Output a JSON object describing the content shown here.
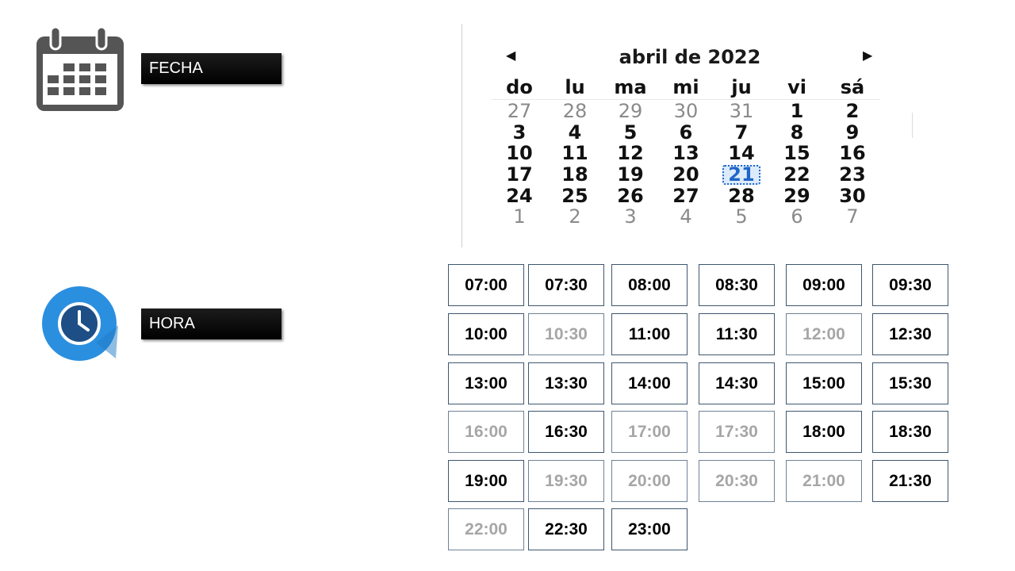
{
  "labels": {
    "fecha": "FECHA",
    "hora": "HORA"
  },
  "icons": {
    "calendar": "calendar-icon",
    "clock": "clock-icon",
    "prev": "chevron-left-icon",
    "next": "chevron-right-icon"
  },
  "colors": {
    "label_bg": "#000000",
    "clock_blue": "#2b8fe0",
    "calendar_gray": "#555555",
    "selected": "#1f66c9",
    "disabled_text": "#a6a6a6"
  },
  "calendar": {
    "title": "abril de 2022",
    "prev_symbol": "◀",
    "next_symbol": "▶",
    "weekdays": [
      "do",
      "lu",
      "ma",
      "mi",
      "ju",
      "vi",
      "sá"
    ],
    "weeks": [
      [
        {
          "d": "27",
          "o": 1
        },
        {
          "d": "28",
          "o": 1
        },
        {
          "d": "29",
          "o": 1
        },
        {
          "d": "30",
          "o": 1
        },
        {
          "d": "31",
          "o": 1
        },
        {
          "d": "1"
        },
        {
          "d": "2"
        }
      ],
      [
        {
          "d": "3"
        },
        {
          "d": "4"
        },
        {
          "d": "5"
        },
        {
          "d": "6"
        },
        {
          "d": "7"
        },
        {
          "d": "8"
        },
        {
          "d": "9"
        }
      ],
      [
        {
          "d": "10"
        },
        {
          "d": "11"
        },
        {
          "d": "12"
        },
        {
          "d": "13"
        },
        {
          "d": "14"
        },
        {
          "d": "15"
        },
        {
          "d": "16"
        }
      ],
      [
        {
          "d": "17"
        },
        {
          "d": "18"
        },
        {
          "d": "19"
        },
        {
          "d": "20"
        },
        {
          "d": "21",
          "s": 1
        },
        {
          "d": "22"
        },
        {
          "d": "23"
        }
      ],
      [
        {
          "d": "24"
        },
        {
          "d": "25"
        },
        {
          "d": "26"
        },
        {
          "d": "27"
        },
        {
          "d": "28"
        },
        {
          "d": "29"
        },
        {
          "d": "30"
        }
      ],
      [
        {
          "d": "1",
          "o": 1
        },
        {
          "d": "2",
          "o": 1
        },
        {
          "d": "3",
          "o": 1
        },
        {
          "d": "4",
          "o": 1
        },
        {
          "d": "5",
          "o": 1
        },
        {
          "d": "6",
          "o": 1
        },
        {
          "d": "7",
          "o": 1
        }
      ]
    ],
    "selected_day": "21"
  },
  "time_slots": [
    {
      "t": "07:00",
      "available": true
    },
    {
      "t": "07:30",
      "available": true
    },
    {
      "t": "08:00",
      "available": true
    },
    {
      "t": "08:30",
      "available": true
    },
    {
      "t": "09:00",
      "available": true
    },
    {
      "t": "09:30",
      "available": true
    },
    {
      "t": "10:00",
      "available": true
    },
    {
      "t": "10:30",
      "available": false
    },
    {
      "t": "11:00",
      "available": true
    },
    {
      "t": "11:30",
      "available": true
    },
    {
      "t": "12:00",
      "available": false
    },
    {
      "t": "12:30",
      "available": true
    },
    {
      "t": "13:00",
      "available": true
    },
    {
      "t": "13:30",
      "available": true
    },
    {
      "t": "14:00",
      "available": true
    },
    {
      "t": "14:30",
      "available": true
    },
    {
      "t": "15:00",
      "available": true
    },
    {
      "t": "15:30",
      "available": true
    },
    {
      "t": "16:00",
      "available": false
    },
    {
      "t": "16:30",
      "available": true
    },
    {
      "t": "17:00",
      "available": false
    },
    {
      "t": "17:30",
      "available": false
    },
    {
      "t": "18:00",
      "available": true
    },
    {
      "t": "18:30",
      "available": true
    },
    {
      "t": "19:00",
      "available": true
    },
    {
      "t": "19:30",
      "available": false
    },
    {
      "t": "20:00",
      "available": false
    },
    {
      "t": "20:30",
      "available": false
    },
    {
      "t": "21:00",
      "available": false
    },
    {
      "t": "21:30",
      "available": true
    },
    {
      "t": "22:00",
      "available": false
    },
    {
      "t": "22:30",
      "available": true
    },
    {
      "t": "23:00",
      "available": true
    }
  ]
}
